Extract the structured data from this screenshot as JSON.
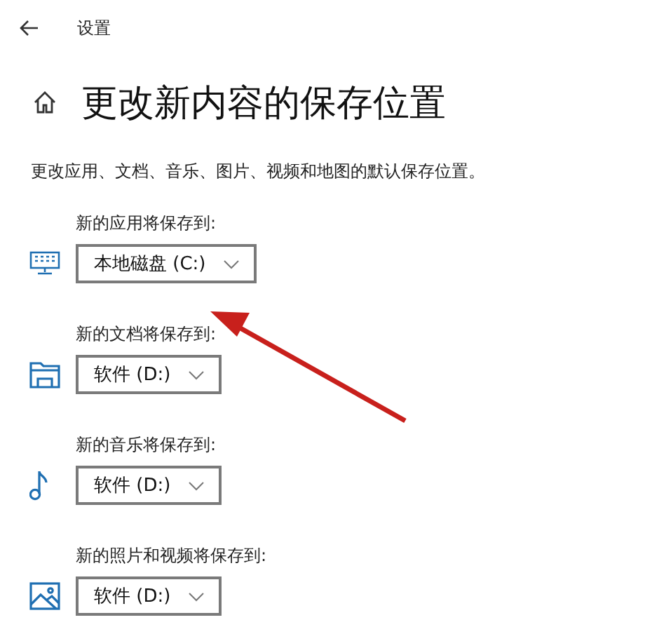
{
  "window": {
    "title": "设置"
  },
  "page": {
    "heading": "更改新内容的保存位置",
    "description": "更改应用、文档、音乐、图片、视频和地图的默认保存位置。"
  },
  "sections": [
    {
      "kind": "apps",
      "label": "新的应用将保存到:",
      "value": "本地磁盘 (C:)"
    },
    {
      "kind": "documents",
      "label": "新的文档将保存到:",
      "value": "软件 (D:)"
    },
    {
      "kind": "music",
      "label": "新的音乐将保存到:",
      "value": "软件 (D:)"
    },
    {
      "kind": "photos",
      "label": "新的照片和视频将保存到:",
      "value": "软件 (D:)"
    }
  ]
}
